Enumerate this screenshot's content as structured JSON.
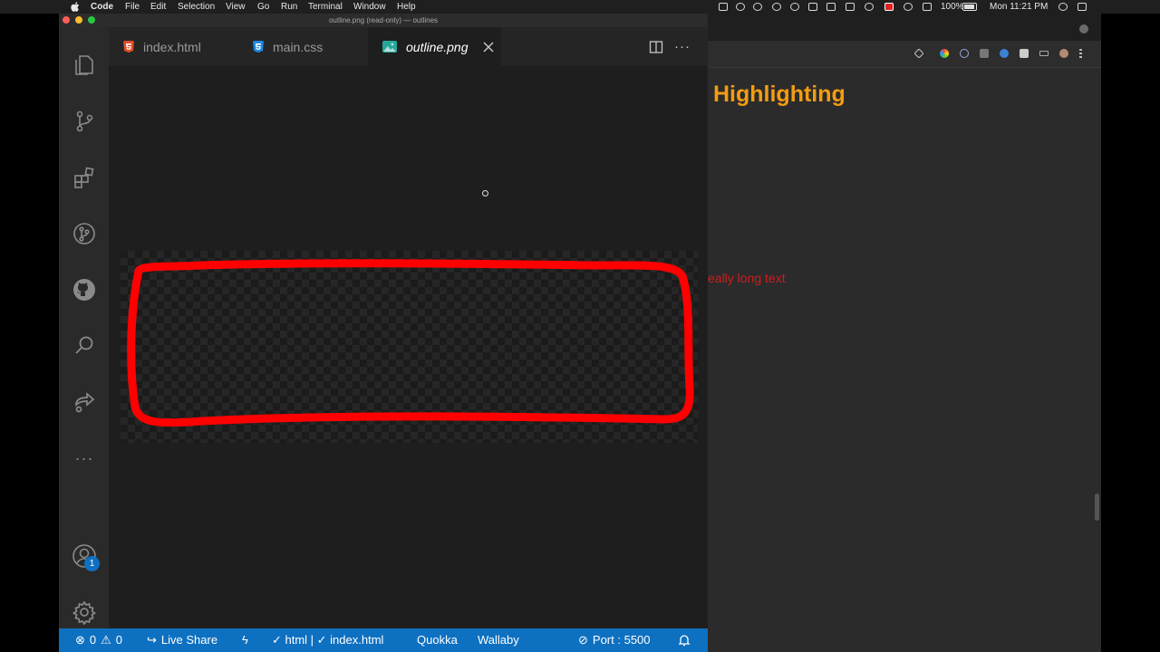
{
  "menubar": {
    "app_name": "Code",
    "items": [
      "File",
      "Edit",
      "Selection",
      "View",
      "Go",
      "Run",
      "Terminal",
      "Window",
      "Help"
    ],
    "battery": "100%",
    "clock": "Mon 11:21 PM"
  },
  "window": {
    "title": "outline.png (read-only) — outlines"
  },
  "tabs": [
    {
      "label": "index.html",
      "icon": "html5-icon",
      "color": "#e44d26"
    },
    {
      "label": "main.css",
      "icon": "css3-icon",
      "color": "#1e88e5"
    },
    {
      "label": "outline.png",
      "icon": "image-icon",
      "color": "#26a69a"
    }
  ],
  "activity_bar": {
    "items": [
      "explorer-icon",
      "source-control-icon",
      "extensions-icon",
      "git-graph-icon",
      "github-icon",
      "search-icon",
      "live-share-icon",
      "more-icon"
    ],
    "account_badge": "1"
  },
  "preview": {
    "outline_color": "#ff0000"
  },
  "statusbar": {
    "errors": "0",
    "warnings": "0",
    "live_share": "Live Share",
    "lang": "✓ html | ✓ index.html",
    "quokka": "Quokka",
    "wallaby": "Wallaby",
    "port": "Port : 5500",
    "color": "#0e70c0"
  },
  "browser": {
    "heading": "Highlighting",
    "text": "eally long text"
  }
}
